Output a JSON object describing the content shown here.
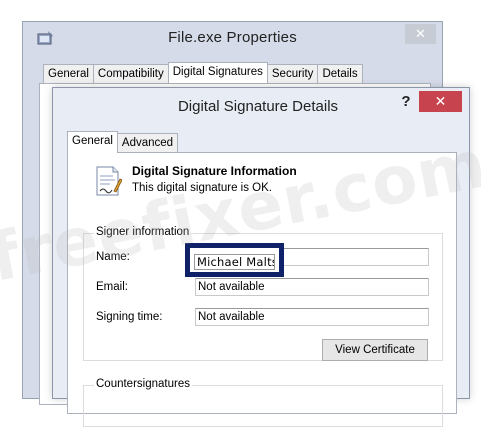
{
  "back_window": {
    "title": "File.exe Properties",
    "close_glyph": "✕",
    "tabs": [
      "General",
      "Compatibility",
      "Digital Signatures",
      "Security",
      "Details"
    ],
    "active_tab": "Digital Signatures"
  },
  "dialog": {
    "title": "Digital Signature Details",
    "help_glyph": "?",
    "close_glyph": "✕",
    "tabs": [
      "General",
      "Advanced"
    ],
    "active_tab": "General",
    "info": {
      "heading": "Digital Signature Information",
      "status": "This digital signature is OK."
    },
    "signer": {
      "legend": "Signer information",
      "name_label": "Name:",
      "name_value": "Michael Maltsev",
      "email_label": "Email:",
      "email_value": "Not available",
      "time_label": "Signing time:",
      "time_value": "Not available"
    },
    "view_certificate_label": "View Certificate",
    "countersignatures_legend": "Countersignatures"
  },
  "watermark": "freefixer.com",
  "colors": {
    "close_button": "#c7434d",
    "highlight_border": "#0f2168",
    "window_bg": "#e8ecf4"
  }
}
